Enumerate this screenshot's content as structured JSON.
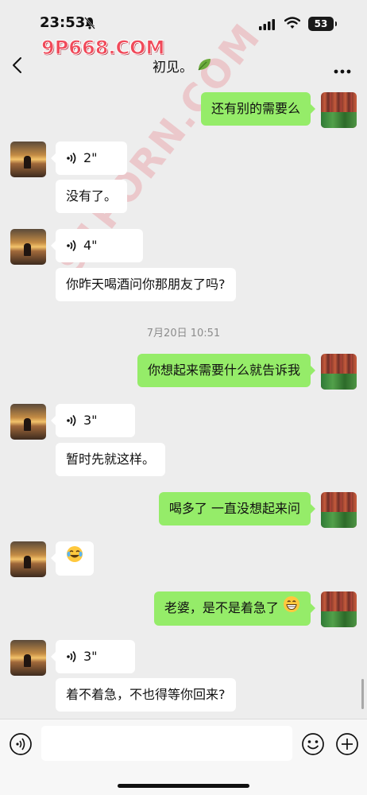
{
  "status_bar": {
    "time": "23:53",
    "battery": "53",
    "icons": [
      "bell-mute-icon",
      "signal-icon",
      "wifi-icon",
      "battery-icon"
    ]
  },
  "watermark": {
    "logo_text": "9P668.COM",
    "diagonal_text": "91PORN.COM"
  },
  "nav": {
    "title": "初见。",
    "title_icon": "leaf-icon",
    "back_icon": "chevron-left-icon",
    "more_icon": "more-dots-icon"
  },
  "messages": [
    {
      "side": "right",
      "type": "text",
      "text": "还有别的需要么"
    },
    {
      "side": "left",
      "type": "voice",
      "duration": "2\""
    },
    {
      "side": "left",
      "type": "text",
      "text": "没有了。"
    },
    {
      "side": "left",
      "type": "voice",
      "duration": "4\""
    },
    {
      "side": "left",
      "type": "text",
      "text": "你昨天喝酒问你那朋友了吗?"
    },
    {
      "type": "timestamp",
      "text": "7月20日 10:51"
    },
    {
      "side": "right",
      "type": "text",
      "text": "你想起来需要什么就告诉我"
    },
    {
      "side": "left",
      "type": "voice",
      "duration": "3\""
    },
    {
      "side": "left",
      "type": "text",
      "text": "暂时先就这样。"
    },
    {
      "side": "right",
      "type": "text",
      "text": "喝多了 一直没想起来问"
    },
    {
      "side": "left",
      "type": "emoji",
      "emoji": "laugh-cry-emoji"
    },
    {
      "side": "right",
      "type": "text",
      "text": "老婆，是不是着急了",
      "emoji": "grin-emoji"
    },
    {
      "side": "left",
      "type": "voice",
      "duration": "3\""
    },
    {
      "side": "left",
      "type": "text",
      "text": "着不着急，不也得等你回来?"
    }
  ],
  "input_bar": {
    "placeholder": "",
    "icons": [
      "voice-toggle-icon",
      "emoji-icon",
      "plus-icon"
    ]
  },
  "colors": {
    "background": "#ededed",
    "sent_bubble": "#95ec69",
    "received_bubble": "#ffffff",
    "timestamp": "#8c8c8c",
    "watermark_logo": "#f04a5a"
  }
}
